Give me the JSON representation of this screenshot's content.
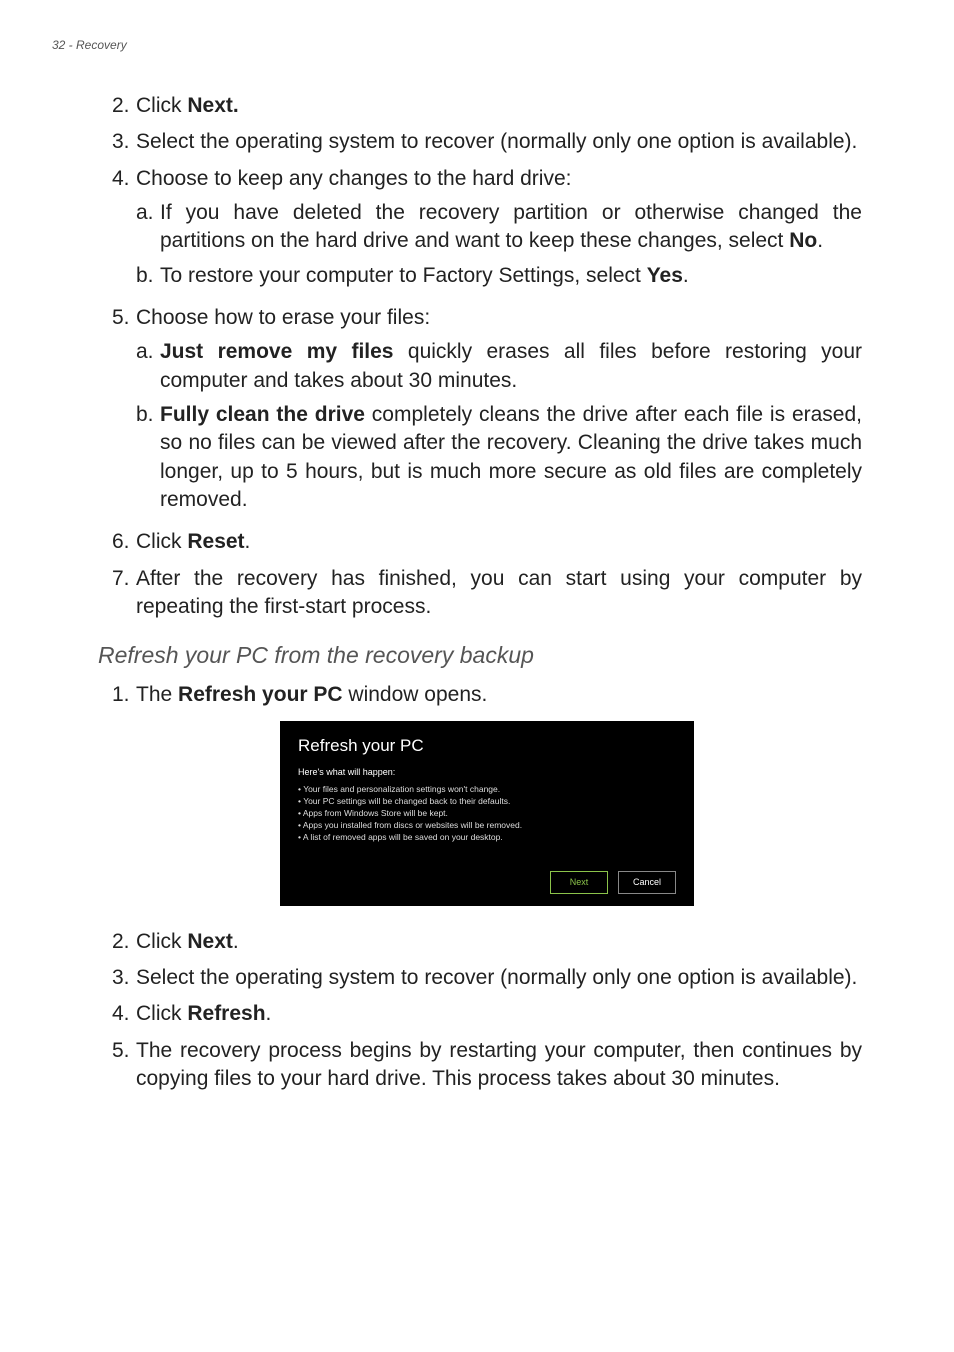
{
  "header": {
    "page_label": "32 - Recovery"
  },
  "steps_a": [
    {
      "n": "2.",
      "pre": "Click ",
      "bold": "Next.",
      "post": ""
    },
    {
      "n": "3.",
      "text": "Select the operating system to recover (normally only one option is available).",
      "justify": true
    },
    {
      "n": "4.",
      "text": "Choose to keep any changes to the hard drive:",
      "subs": [
        {
          "l": "a.",
          "text_pre": "If you have deleted the recovery partition or otherwise changed the partitions on the hard drive and want to keep these changes, select ",
          "bold": "No",
          "text_post": ".",
          "justify": true
        },
        {
          "l": "b.",
          "text_pre": "To restore your computer to Factory Settings, select ",
          "bold": "Yes",
          "text_post": "."
        }
      ]
    },
    {
      "n": "5.",
      "text": "Choose how to erase your files:",
      "subs": [
        {
          "l": "a.",
          "leadbold": "Just remove my files",
          "rest": " quickly erases all files before restoring your computer and takes about 30 minutes.",
          "justify": true
        },
        {
          "l": "b.",
          "leadbold": "Fully clean the drive",
          "rest": " completely cleans the drive after each file is erased, so no files can be viewed after the recovery. Cleaning the drive takes much longer, up to 5 hours, but is much more secure as old files are completely removed.",
          "justify": true
        }
      ]
    },
    {
      "n": "6.",
      "pre": "Click ",
      "bold": "Reset",
      "post": "."
    },
    {
      "n": "7.",
      "text": "After the recovery has finished, you can start using your computer by repeating the first-start process.",
      "justify": true
    }
  ],
  "section_heading": "Refresh your PC from the recovery backup",
  "steps_b_1": {
    "n": "1.",
    "pre": "The ",
    "bold": "Refresh your PC",
    "post": " window opens."
  },
  "dialog": {
    "title": "Refresh your PC",
    "subtitle": "Here's what will happen:",
    "bullets": [
      "Your files and personalization settings won't change.",
      "Your PC settings will be changed back to their defaults.",
      "Apps from Windows Store will be kept.",
      "Apps you installed from discs or websites will be removed.",
      "A list of removed apps will be saved on your desktop."
    ],
    "next": "Next",
    "cancel": "Cancel"
  },
  "steps_b_rest": [
    {
      "n": "2.",
      "pre": "Click ",
      "bold": "Next",
      "post": "."
    },
    {
      "n": "3.",
      "text": "Select the operating system to recover (normally only one option is available).",
      "justify": true
    },
    {
      "n": "4.",
      "pre": "Click ",
      "bold": "Refresh",
      "post": "."
    },
    {
      "n": "5.",
      "text": "The recovery process begins by restarting your computer, then continues by copying files to your hard drive. This process takes about 30 minutes.",
      "justify": true
    }
  ]
}
